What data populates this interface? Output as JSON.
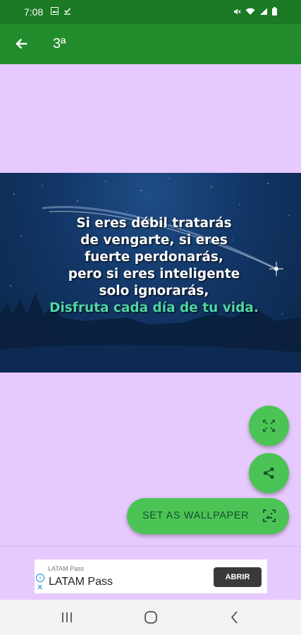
{
  "status": {
    "time": "7:08",
    "left_icons": [
      "image-icon",
      "download-done-icon"
    ],
    "right_icons": [
      "mute-icon",
      "wifi-icon",
      "signal-icon",
      "battery-icon"
    ]
  },
  "app_bar": {
    "title": "3ª",
    "color": "#228b2b"
  },
  "image": {
    "quote_lines": [
      "Si eres débil tratarás",
      "de vengarte, si eres",
      "fuerte perdonarás,",
      "pero si eres inteligente",
      "solo ignorarás,"
    ],
    "quote_highlight": "Disfruta cada día de tu vida.",
    "highlight_color": "#4fd6a5"
  },
  "actions": {
    "fullscreen_icon": "fullscreen-icon",
    "share_icon": "share-icon",
    "set_wallpaper_label": "SET AS WALLPAPER",
    "wallpaper_icon": "wallpaper-icon",
    "fab_color": "#4cc455"
  },
  "ad": {
    "advertiser_small": "LATAM Pass",
    "advertiser": "LATAM Pass",
    "cta": "ABRIR"
  },
  "nav": {
    "recents_icon": "recents-icon",
    "home_icon": "home-icon",
    "back_icon": "back-icon"
  }
}
